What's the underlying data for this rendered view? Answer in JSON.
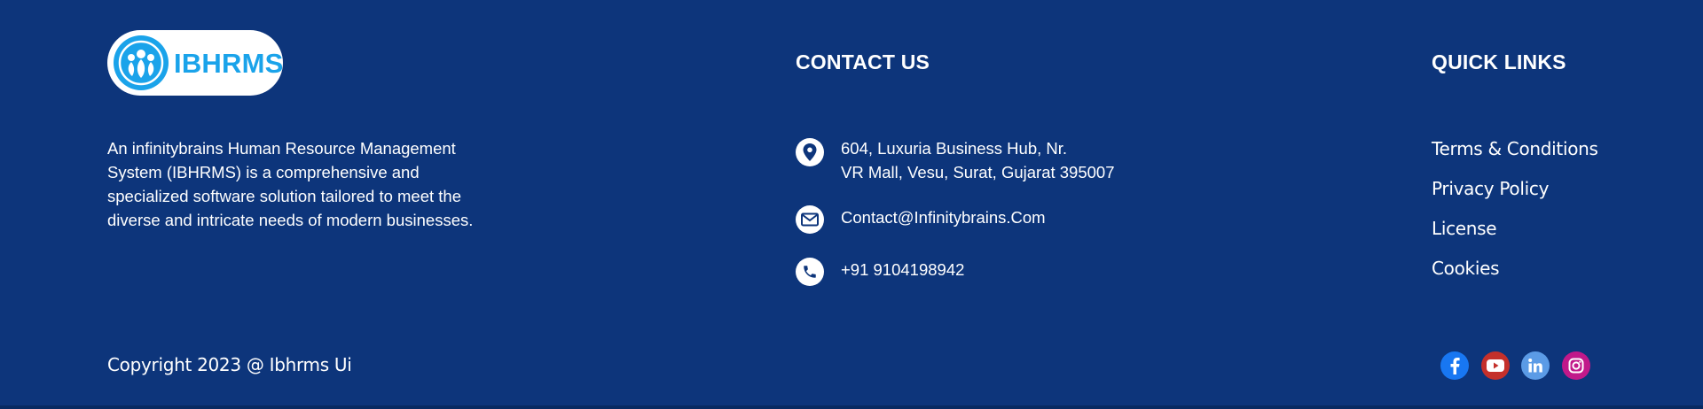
{
  "brand": {
    "name": "IBHRMS"
  },
  "about": {
    "text": "An infinitybrains Human Resource Management System (IBHRMS) is a comprehensive and specialized software solution tailored to meet the diverse and intricate needs of modern businesses."
  },
  "contact": {
    "heading": "CONTACT US",
    "address_line1": "604, Luxuria Business Hub, Nr.",
    "address_line2": "VR Mall, Vesu, Surat, Gujarat 395007",
    "email": "Contact@Infinitybrains.Com",
    "phone": "+91 9104198942"
  },
  "quick_links": {
    "heading": "QUICK LINKS",
    "items": [
      "Terms & Conditions",
      "Privacy Policy",
      "License",
      "Cookies"
    ]
  },
  "copyright": "Copyright 2023 @ Ibhrms Ui",
  "social": [
    {
      "name": "facebook-icon",
      "color": "#1877f2"
    },
    {
      "name": "youtube-icon",
      "color": "#c4302b"
    },
    {
      "name": "linkedin-icon",
      "color": "#5b9be6"
    },
    {
      "name": "instagram-icon",
      "color": "#c1198a"
    }
  ],
  "colors": {
    "background": "#0d357b",
    "brand_blue": "#1aa3ea",
    "text": "#ffffff"
  }
}
